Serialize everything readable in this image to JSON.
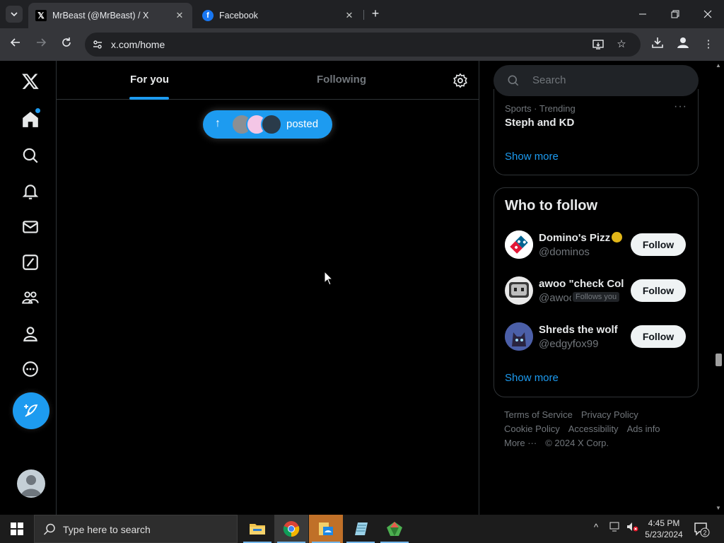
{
  "browser": {
    "tabs": [
      {
        "title": "MrBeast (@MrBeast) / X",
        "favicon": "x-favicon",
        "active": true
      },
      {
        "title": "Facebook",
        "favicon": "facebook-favicon",
        "active": false
      }
    ],
    "new_tab": "+",
    "url": "x.com/home",
    "window_controls": {
      "minimize": "—",
      "restore": "❐",
      "close": "✕"
    }
  },
  "x": {
    "timeline_tabs": {
      "for_you": "For you",
      "following": "Following"
    },
    "posted_pill": {
      "label": "posted",
      "arrow": "↑"
    },
    "search": {
      "placeholder": "Search"
    },
    "trend": {
      "meta": "Sports · Trending",
      "title": "Steph and KD",
      "more": "···"
    },
    "show_more_trend": "Show more",
    "who_to_follow": {
      "title": "Who to follow",
      "accounts": [
        {
          "name": "Domino's Pizz",
          "handle": "@dominos",
          "verified": true,
          "follow_label": "Follow"
        },
        {
          "name": "awoo \"check Col",
          "handle": "@awoo",
          "follows_you": "Follows you",
          "follow_label": "Follow"
        },
        {
          "name": "Shreds the wolf",
          "handle": "@edgyfox99",
          "follow_label": "Follow"
        }
      ],
      "show_more": "Show more"
    },
    "footer": {
      "terms": "Terms of Service",
      "privacy": "Privacy Policy",
      "cookie": "Cookie Policy",
      "accessibility": "Accessibility",
      "ads": "Ads info",
      "more": "More ···",
      "copyright": "© 2024 X Corp."
    },
    "accent_color": "#1d9bf0"
  },
  "taskbar": {
    "search_placeholder": "Type here to search",
    "time": "4:45 PM",
    "date": "5/23/2024",
    "notification_count": "2",
    "tray_chevron": "^"
  }
}
